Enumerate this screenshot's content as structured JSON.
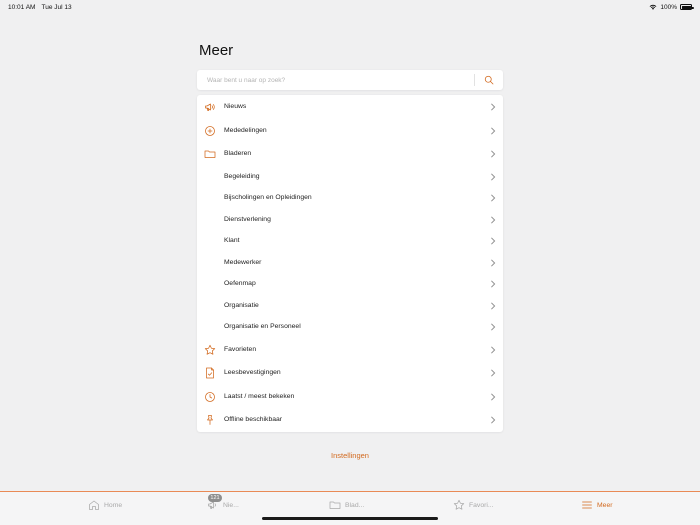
{
  "status_bar": {
    "time": "10:01 AM",
    "date": "Tue Jul 13",
    "battery": "100%"
  },
  "page": {
    "title": "Meer"
  },
  "search": {
    "placeholder": "Waar bent u naar op zoek?"
  },
  "menu": {
    "items": [
      {
        "label": "Nieuws",
        "icon": "megaphone-icon"
      },
      {
        "label": "Mededelingen",
        "icon": "plus-circle-icon"
      },
      {
        "label": "Bladeren",
        "icon": "folder-icon"
      },
      {
        "label": "Begeleiding"
      },
      {
        "label": "Bijscholingen en Opleidingen"
      },
      {
        "label": "Dienstverlening"
      },
      {
        "label": "Klant"
      },
      {
        "label": "Medewerker"
      },
      {
        "label": "Oefenmap"
      },
      {
        "label": "Organisatie"
      },
      {
        "label": "Organisatie en Personeel"
      },
      {
        "label": "Favorieten",
        "icon": "star-icon"
      },
      {
        "label": "Leesbevestigingen",
        "icon": "document-check-icon"
      },
      {
        "label": "Laatst / meest bekeken",
        "icon": "clock-icon"
      },
      {
        "label": "Offline beschikbaar",
        "icon": "pin-icon"
      }
    ]
  },
  "settings": {
    "label": "Instellingen"
  },
  "tabbar": {
    "tabs": [
      {
        "label": "Home",
        "icon": "home-icon"
      },
      {
        "label": "Nie...",
        "icon": "megaphone-icon",
        "badge": "121"
      },
      {
        "label": "Blad...",
        "icon": "folder-icon"
      },
      {
        "label": "Favori...",
        "icon": "star-icon"
      },
      {
        "label": "Meer",
        "icon": "hamburger-icon"
      }
    ]
  },
  "colors": {
    "accent": "#d2691e",
    "background": "#f0f0f1",
    "inactive": "#a9a9a9"
  }
}
